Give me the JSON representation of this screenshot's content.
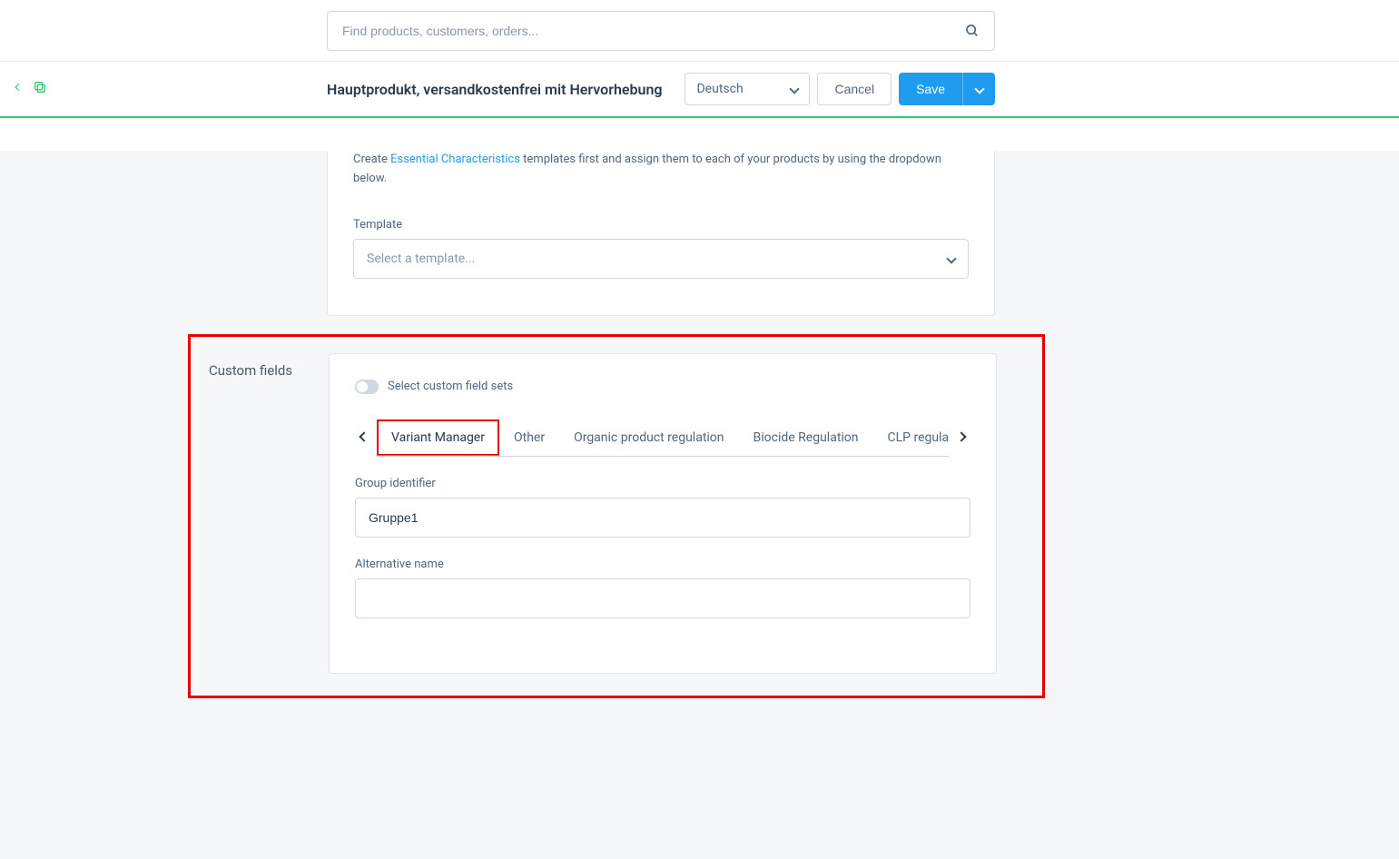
{
  "search": {
    "placeholder": "Find products, customers, orders..."
  },
  "header": {
    "title": "Hauptprodukt, versandkostenfrei mit Hervorhebung",
    "language": "Deutsch",
    "cancel": "Cancel",
    "save": "Save"
  },
  "upper_card": {
    "desc_prefix": "Create ",
    "desc_link": "Essential Characteristics",
    "desc_suffix": " templates first and assign them to each of your products by using the dropdown below.",
    "template_label": "Template",
    "template_placeholder": "Select a template..."
  },
  "custom_fields": {
    "section_title": "Custom fields",
    "toggle_label": "Select custom field sets",
    "tabs": [
      "Variant Manager",
      "Other",
      "Organic product regulation",
      "Biocide Regulation",
      "CLP regulat"
    ],
    "group_identifier_label": "Group identifier",
    "group_identifier_value": "Gruppe1",
    "alternative_name_label": "Alternative name",
    "alternative_name_value": ""
  }
}
